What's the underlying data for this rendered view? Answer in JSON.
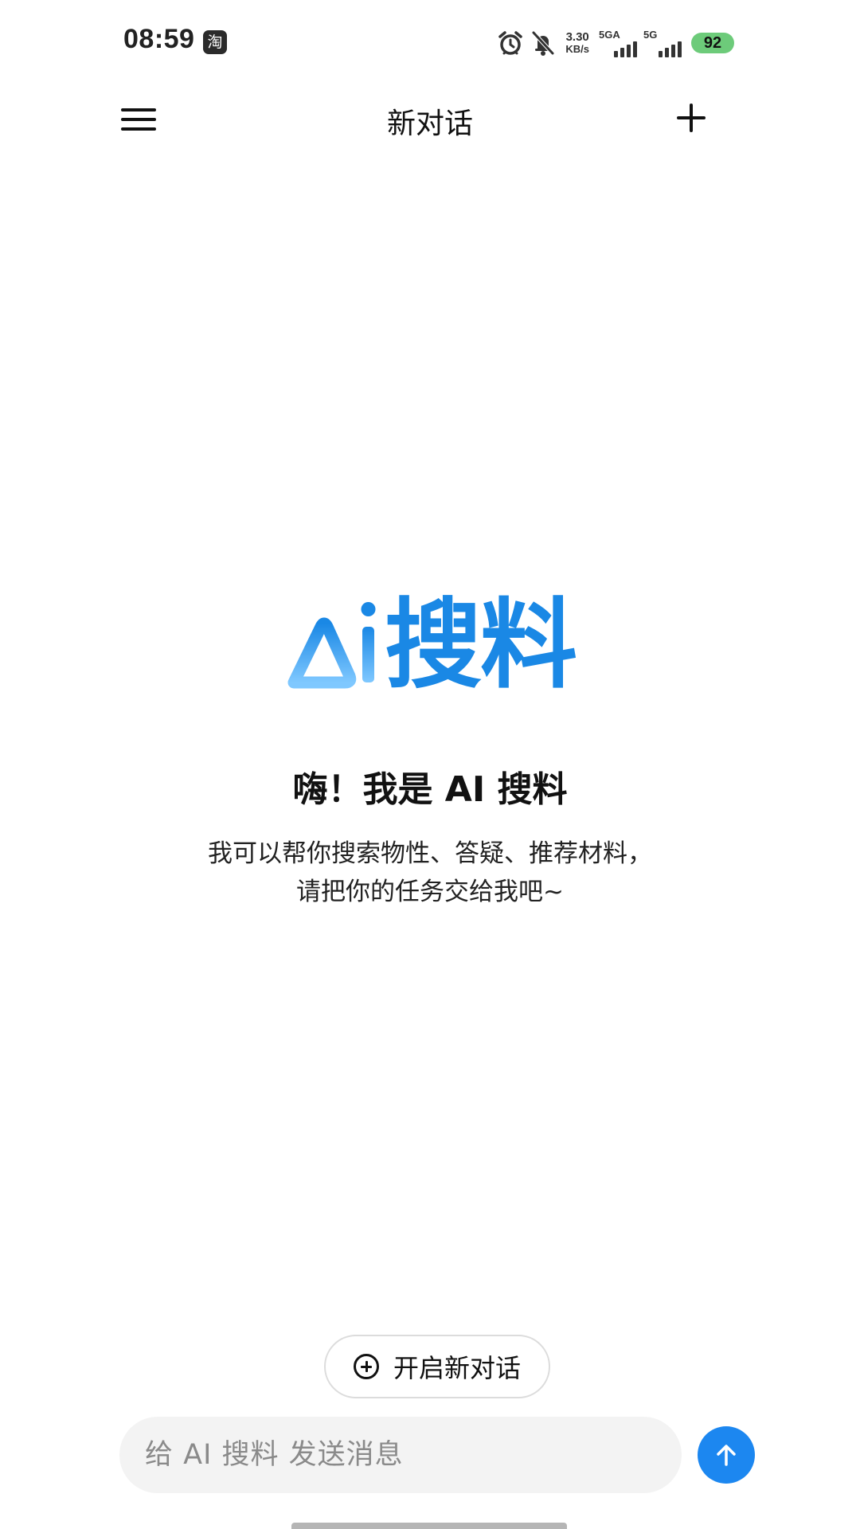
{
  "status_bar": {
    "time": "08:59",
    "app_notification_glyph": "淘",
    "net_speed_value": "3.30",
    "net_speed_unit": "KB/s",
    "sim1_label": "5GA",
    "sim2_label": "5G",
    "battery": "92",
    "icons": [
      "alarm-icon",
      "mute-bell-icon",
      "signal-icon",
      "battery-icon"
    ]
  },
  "header": {
    "title": "新对话",
    "menu_icon": "hamburger-menu-icon",
    "add_icon": "plus-icon"
  },
  "welcome": {
    "logo_text": "搜料",
    "greeting": "嗨！我是 AI 搜料",
    "subtitle_line1": "我可以帮你搜索物性、答疑、推荐材料，",
    "subtitle_line2": "请把你的任务交给我吧~"
  },
  "new_chat_button": {
    "label": "开启新对话",
    "icon": "circle-plus-icon"
  },
  "composer": {
    "placeholder": "给 AI 搜料 发送消息",
    "value": "",
    "send_icon": "arrow-up-icon"
  },
  "colors": {
    "brand_blue": "#1a88e5",
    "send_button": "#1c87f0",
    "battery_green": "#6dcb7a",
    "input_bg": "#f3f3f3"
  }
}
